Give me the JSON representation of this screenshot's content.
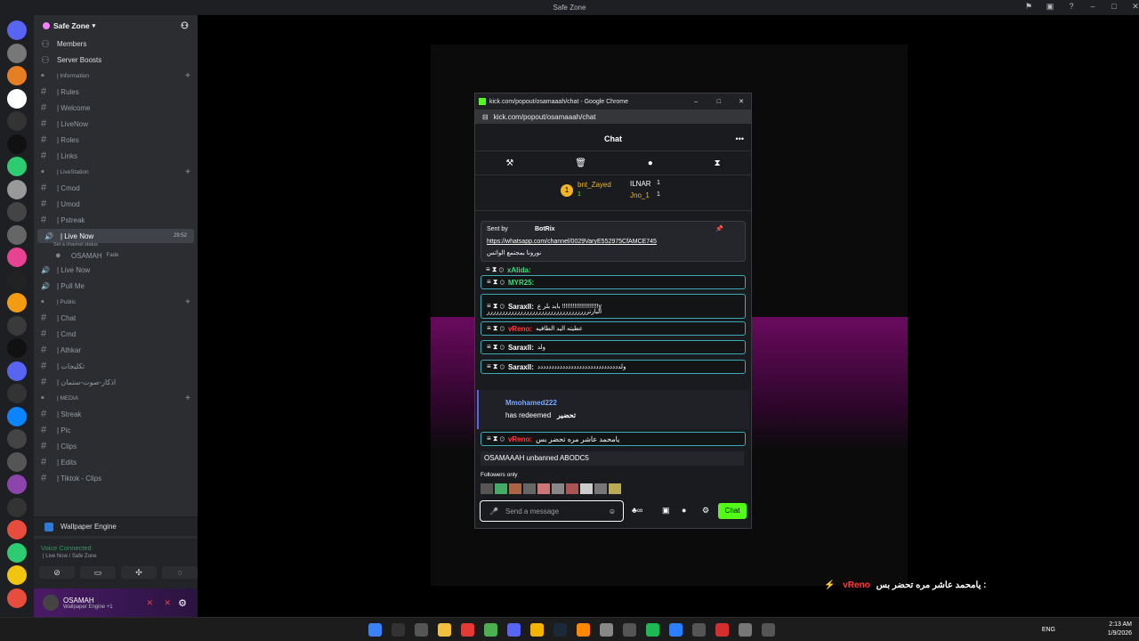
{
  "window": {
    "title": "Safe Zone"
  },
  "guild": {
    "name": "Safe Zone"
  },
  "channels": [
    {
      "type": "top",
      "label": "Members",
      "icon": "members-icon"
    },
    {
      "type": "top",
      "label": "Server Boosts",
      "icon": "boost-icon"
    },
    {
      "type": "cat",
      "label": "| Information"
    },
    {
      "type": "ch",
      "label": "| Rules"
    },
    {
      "type": "ch",
      "label": "| Welcome"
    },
    {
      "type": "ch",
      "label": "| LiveNow"
    },
    {
      "type": "ch",
      "label": "| Roles"
    },
    {
      "type": "ch",
      "label": "| Links"
    },
    {
      "type": "cat",
      "label": "| LiveStation"
    },
    {
      "type": "ch",
      "label": "| Cmod"
    },
    {
      "type": "ch",
      "label": "| Umod"
    },
    {
      "type": "ch",
      "label": "| Pstreak"
    },
    {
      "type": "sel",
      "label": "| Live Now",
      "time": "29:52",
      "sub": "Set a channel status"
    },
    {
      "type": "user",
      "label": "OSAMAH",
      "extra": "Fade"
    },
    {
      "type": "voice",
      "label": "| Live Now"
    },
    {
      "type": "voice",
      "label": "| Pull Me"
    },
    {
      "type": "cat",
      "label": "| Public"
    },
    {
      "type": "ch",
      "label": "| Chat"
    },
    {
      "type": "ch",
      "label": "| Cmd"
    },
    {
      "type": "ch",
      "label": "| Athkar"
    },
    {
      "type": "ch",
      "label": "| تكليجات"
    },
    {
      "type": "ch",
      "label": "| اذكار-صوت-ستمان"
    },
    {
      "type": "cat",
      "label": "| MEDIA"
    },
    {
      "type": "ch",
      "label": "| Streak"
    },
    {
      "type": "ch",
      "label": "| Pic"
    },
    {
      "type": "ch",
      "label": "| Clips"
    },
    {
      "type": "ch",
      "label": "| Edits"
    },
    {
      "type": "ch",
      "label": "| Tiktok - Clips"
    }
  ],
  "wallpaper": {
    "label": "Wallpaper Engine"
  },
  "voice": {
    "status": "Voice Connected",
    "sub": "| Live Now / Safe Zone"
  },
  "user": {
    "name": "OSAMAH",
    "status": "Wallpaper Engine +1"
  },
  "popup": {
    "title": "kick.com/popout/osamaaah/chat - Google Chrome",
    "url": "kick.com/popout/osamaaah/chat",
    "header": "Chat",
    "leader1": "bnt_Zayed",
    "leader1_count": "1",
    "leader2": "ILNAR",
    "leader2_count": "1",
    "leader3": "Jno_1",
    "leader3_count": "1",
    "pin_sender": "Sent by",
    "pin_bot": "BotRix",
    "pin_link": "https://whatsapp.com/channel/0029VaryE552975CfAMCE745",
    "pin_text": "نورونا بمجتمع الواتس",
    "messages": [
      {
        "name": "xAlida:",
        "text": "",
        "color": "#3fdc7a"
      },
      {
        "name": "MYR25:",
        "text": "",
        "color": "#3fdc7a"
      },
      {
        "name": "SaraxII:",
        "text": "بابد بلر ع !!!!!!!!!!!!!!!!!!!!!y",
        "text2": "البارترررررررررررررررررررررررررررررررررر",
        "color": "#ffffff"
      },
      {
        "name": "vReno:",
        "text": "عطيته اليد الطافيه",
        "color": "#ff3b3b"
      },
      {
        "name": "SaraxII:",
        "text": "ولد",
        "color": "#ffffff"
      },
      {
        "name": "SaraxII:",
        "text": "ولدددددددددددددددددددددددددددددد",
        "color": "#ffffff"
      }
    ],
    "redeem_user": "Mmohamed222",
    "redeem_text": "has redeemed",
    "redeem_reward": "تحضير",
    "last_name": "vReno:",
    "last_text": "يامحمد عاشر مره تحضر بس",
    "last_color": "#ff3b3b",
    "unban": "OSAMAAAH unbanned ABODC5",
    "followers": "Followers only",
    "placeholder": "Send a message",
    "chat_btn": "Chat"
  },
  "overlay": {
    "name": "vReno",
    "text": "يامحمد عاشر مره تحضر بس :"
  },
  "tray": {
    "lang": "ENG",
    "time": "2:13 AM",
    "date": "1/9/2026"
  }
}
